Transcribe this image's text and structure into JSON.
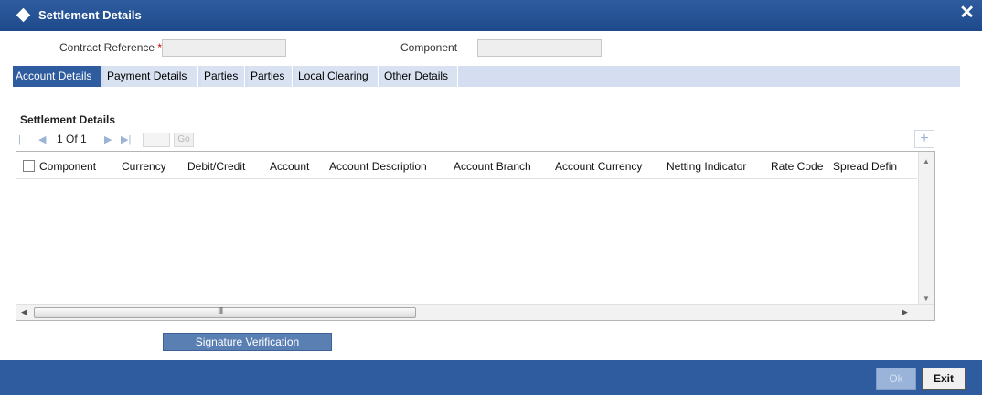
{
  "window": {
    "title": "Settlement Details",
    "close_glyph": "✕"
  },
  "header": {
    "contract_reference_label": "Contract Reference",
    "required_marker": "*",
    "contract_reference_value": "",
    "component_label": "Component",
    "component_value": ""
  },
  "tabs": [
    {
      "label": "Account Details",
      "active": true
    },
    {
      "label": "Payment Details",
      "active": false
    },
    {
      "label": "Parties",
      "active": false
    },
    {
      "label": "Parties",
      "active": false
    },
    {
      "label": "Local Clearing",
      "active": false
    },
    {
      "label": "Other Details",
      "active": false
    }
  ],
  "section": {
    "title": "Settlement Details"
  },
  "pager": {
    "first_glyph": "|◀",
    "prev_glyph": "◀",
    "page_text": "1 Of 1",
    "next_glyph": "▶",
    "last_glyph": "▶|",
    "go_label": "Go",
    "add_glyph": "+"
  },
  "grid": {
    "columns": [
      "Component",
      "Currency",
      "Debit/Credit",
      "Account",
      "Account Description",
      "Account Branch",
      "Account Currency",
      "Netting Indicator",
      "Rate Code",
      "Spread Defin"
    ],
    "rows": [],
    "hscroll_grip": "III"
  },
  "actions": {
    "signature_verification": "Signature Verification"
  },
  "footer": {
    "ok_label": "Ok",
    "exit_label": "Exit"
  },
  "colors": {
    "accent": "#2f5c9e",
    "tab_bg": "#d9e2f1",
    "required": "#d40000"
  }
}
